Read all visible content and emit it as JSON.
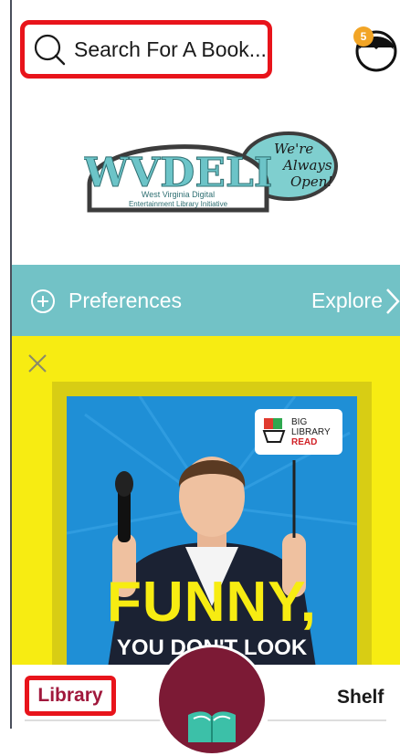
{
  "search": {
    "placeholder": "Search For A Book..."
  },
  "account": {
    "badge_count": "5"
  },
  "logo": {
    "title": "WVDELI",
    "subtitle_line1": "West Virginia Digital",
    "subtitle_line2": "Entertainment Library Initiative",
    "tagline1": "We're",
    "tagline2": "Always",
    "tagline3": "Open!"
  },
  "preferences_bar": {
    "preferences_label": "Preferences",
    "explore_label": "Explore"
  },
  "promo": {
    "badge_line1": "BIG",
    "badge_line2": "LIBRARY",
    "badge_line3": "READ",
    "headline": "FUNNY,",
    "subline": "YOU DON'T LOOK"
  },
  "bottom_nav": {
    "library_label": "Library",
    "shelf_label": "Shelf"
  },
  "colors": {
    "accent_red": "#e8141b",
    "teal": "#72c2c6",
    "promo_yellow": "#f7ec12",
    "brand_maroon": "#7c1a35",
    "badge_orange": "#f2a526"
  }
}
